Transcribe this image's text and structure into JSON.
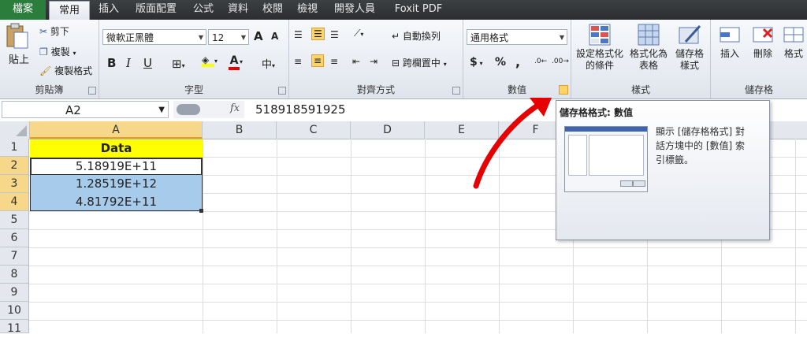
{
  "tabs": [
    "檔案",
    "常用",
    "插入",
    "版面配置",
    "公式",
    "資料",
    "校閱",
    "檢視",
    "開發人員",
    "Foxit PDF"
  ],
  "ribbon": {
    "clipboard": {
      "paste": "貼上",
      "cut": "剪下",
      "copy": "複製",
      "format_painter": "複製格式",
      "label": "剪貼簿"
    },
    "font": {
      "name": "微軟正黑體",
      "size": "12",
      "grow": "A",
      "shrink": "A",
      "bold": "B",
      "italic": "I",
      "underline": "U",
      "label": "字型"
    },
    "alignment": {
      "wrap": "自動換列",
      "merge": "跨欄置中",
      "label": "對齊方式"
    },
    "number": {
      "format": "通用格式",
      "currency": "$",
      "percent": "%",
      "comma": ",",
      "label": "數值"
    },
    "styles": {
      "conditional": "設定格式化的條件",
      "conditional_l1": "設定格式化",
      "conditional_l2": "的條件",
      "table_l1": "格式化為",
      "table_l2": "表格",
      "cell_l1": "儲存格",
      "cell_l2": "樣式",
      "label": "樣式"
    },
    "cells": {
      "insert": "插入",
      "delete": "刪除",
      "format": "格式",
      "label": "儲存格"
    }
  },
  "formula_bar": {
    "name_box": "A2",
    "fx": "fx",
    "content": "518918591925"
  },
  "columns": [
    "A",
    "B",
    "C",
    "D",
    "E",
    "F"
  ],
  "rows": [
    "1",
    "2",
    "3",
    "4",
    "5",
    "6",
    "7",
    "8",
    "9",
    "10",
    "11"
  ],
  "cells": {
    "A1": "Data",
    "A2": "5.18919E+11",
    "A3": "1.28519E+12",
    "A4": "4.81792E+11"
  },
  "tooltip": {
    "title": "儲存格格式: 數值",
    "line1": "顯示 [儲存格格式] 對",
    "line2": "話方塊中的 [數值] 索",
    "line3": "引標籤。"
  },
  "colors": {
    "header_fill": "#ffff00",
    "selected_fill": "#a7cbea",
    "arrow": "#e60000",
    "file_tab": "#2a7d3a"
  }
}
